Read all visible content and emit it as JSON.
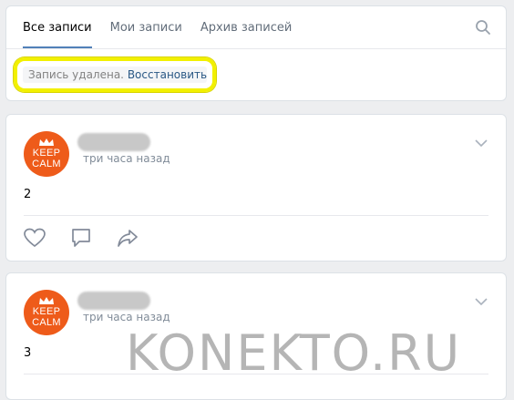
{
  "tabs": [
    {
      "label": "Все записи",
      "active": true
    },
    {
      "label": "Мои записи",
      "active": false
    },
    {
      "label": "Архив записей",
      "active": false
    }
  ],
  "deleted_notice": {
    "text": "Запись удалена.",
    "restore_label": "Восстановить"
  },
  "posts": [
    {
      "avatar_text": [
        "KEEP",
        "CALM"
      ],
      "time": "три часа назад",
      "text": "2"
    },
    {
      "avatar_text": [
        "KEEP",
        "CALM"
      ],
      "time": "три часа назад",
      "text": "3"
    }
  ],
  "icons": [
    "search-icon",
    "chevron-down-icon",
    "like-icon",
    "comment-icon",
    "share-icon"
  ],
  "colors": {
    "accent": "#5181b8",
    "link": "#2a5885",
    "highlight": "#f2f000",
    "avatar": "#ee5b1a"
  },
  "watermark": "KONEKTO.RU"
}
